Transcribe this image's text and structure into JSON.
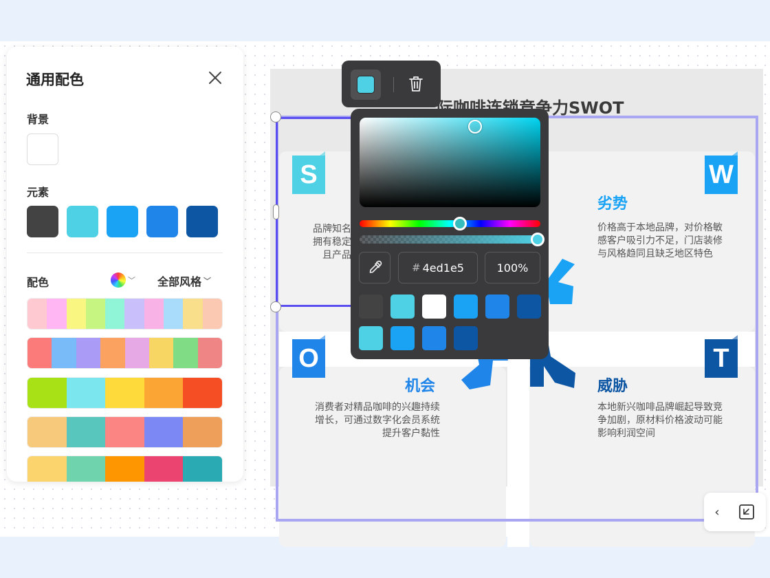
{
  "panel": {
    "title": "通用配色",
    "background_label": "背景",
    "background_color": "#ffffff",
    "elements_label": "元素",
    "element_colors": [
      "#434343",
      "#4ed1e5",
      "#1aa3f5",
      "#2085e8",
      "#0c56a3"
    ],
    "palette_label": "配色",
    "style_filter": "全部风格",
    "palettes": [
      [
        "#ffc9d1",
        "#ffb6f2",
        "#f9f681",
        "#c7f581",
        "#8ff5d6",
        "#c9c0fb",
        "#f9b2e5",
        "#a8dcfa",
        "#f9de8c",
        "#fbc8b2"
      ],
      [
        "#fb7a7a",
        "#79baf9",
        "#a99bf6",
        "#fba261",
        "#e7a9e6",
        "#f8d663",
        "#81dd85",
        "#f08586"
      ],
      [
        "#a8e216",
        "#7be6ee",
        "#fedb3a",
        "#fba534",
        "#f54e24"
      ],
      [
        "#f7c97a",
        "#59c6bd",
        "#fb8582",
        "#7c88f4",
        "#ee9f59"
      ],
      [
        "#fbd46e",
        "#6fd3ae",
        "#fd9600",
        "#ec4470",
        "#2aaab3"
      ]
    ]
  },
  "board": {
    "title": "际咖啡连锁竞争力SWOT",
    "strengths": {
      "letter": "S",
      "title": "",
      "lines": [
        "品牌知名",
        "拥有稳定",
        "且产品"
      ],
      "color": "#4ed1e5"
    },
    "weaknesses": {
      "letter": "W",
      "title": "劣势",
      "text": "价格高于本地品牌，对价格敏感客户吸引力不足，门店装修与风格趋同且缺乏地区特色",
      "color": "#1aa3f5"
    },
    "opportunities": {
      "letter": "O",
      "title": "机会",
      "text": "消费者对精品咖啡的兴趣持续增长，可通过数字化会员系统提升客户黏性",
      "color": "#2085e8"
    },
    "threats": {
      "letter": "T",
      "title": "威胁",
      "text": "本地新兴咖啡品牌崛起导致竞争加剧，原材料价格波动可能影响利润空间",
      "color": "#0c56a3"
    }
  },
  "toolbar": {
    "current_color": "#4ed1e5"
  },
  "picker": {
    "hex": "4ed1e5",
    "hash": "#",
    "opacity": "100%",
    "hue_fraction": 0.53,
    "alpha_fraction": 1.0,
    "swatches_row1": [
      "#434343",
      "#4ed1e5",
      "#ffffff",
      "#1aa3f5",
      "#2085e8",
      "#0c56a3"
    ],
    "swatches_row2": [
      "#4ed1e5",
      "#1aa3f5",
      "#2085e8",
      "#0c56a3"
    ]
  },
  "corner": {
    "collapse_icon": "chevron-left-icon",
    "fit_icon": "fit-screen-icon"
  }
}
